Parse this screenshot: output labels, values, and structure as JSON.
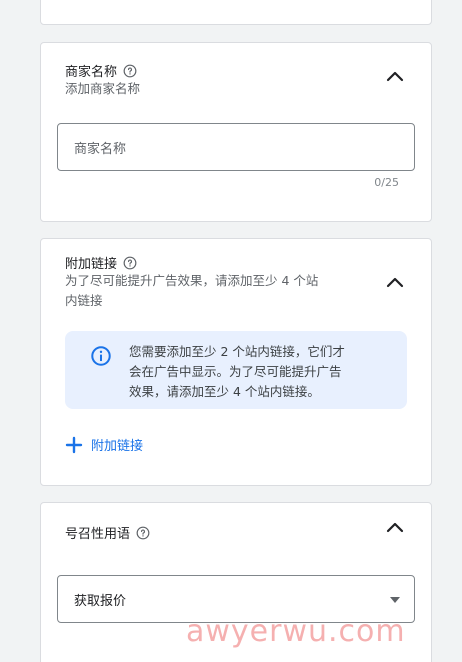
{
  "merchant": {
    "title": "商家名称",
    "subtitle": "添加商家名称",
    "input_placeholder": "商家名称",
    "counter": "0/25"
  },
  "sitelinks": {
    "title": "附加链接",
    "subtitle_line1": "为了尽可能提升广告效果，请添加至少 4 个站",
    "subtitle_line2": "内链接",
    "info_line1": "您需要添加至少 2 个站内链接，它们才",
    "info_line2": "会在广告中显示。为了尽可能提升广告",
    "info_line3": "效果，请添加至少 4 个站内链接。",
    "add_label": "附加链接"
  },
  "call_to_action": {
    "title": "号召性用语",
    "selected_value": "获取报价"
  },
  "watermark": "awyerwu.com",
  "colors": {
    "accent": "#1a73e8",
    "info_bg": "#e8f0fe",
    "border": "#dadce0"
  }
}
